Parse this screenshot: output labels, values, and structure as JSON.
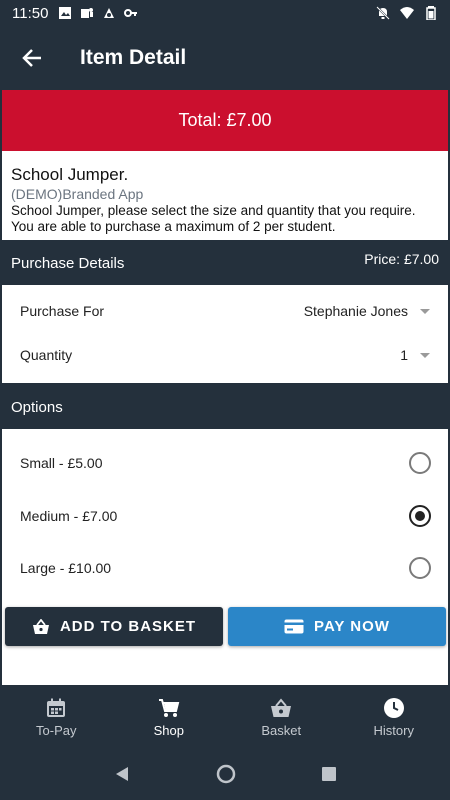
{
  "status": {
    "time": "11:50",
    "left_icons": [
      "image-icon",
      "teams-icon",
      "tomorrow-icon",
      "key-icon"
    ],
    "right_icons": [
      "bell-off-icon",
      "wifi-icon",
      "battery-icon"
    ]
  },
  "app_bar": {
    "title": "Item Detail",
    "back_icon": "arrow-left-icon"
  },
  "total": {
    "label": "Total: £7.00"
  },
  "item": {
    "name": "School Jumper.",
    "vendor": "(DEMO)Branded App",
    "description": "School Jumper, please select the size and quantity that you require. You are able to purchase a maximum of 2 per student."
  },
  "purchase_details": {
    "header": "Purchase Details",
    "price": "Price: £7.00",
    "purchase_for_label": "Purchase For",
    "purchase_for_value": "Stephanie Jones",
    "quantity_label": "Quantity",
    "quantity_value": "1"
  },
  "options": {
    "header": "Options",
    "items": [
      {
        "label": "Small - £5.00",
        "selected": false
      },
      {
        "label": "Medium - £7.00",
        "selected": true
      },
      {
        "label": "Large - £10.00",
        "selected": false
      }
    ]
  },
  "buttons": {
    "add_to_basket": "ADD TO BASKET",
    "pay_now": "PAY NOW"
  },
  "bottom_nav": {
    "items": [
      {
        "label": "To-Pay",
        "icon": "calendar-icon"
      },
      {
        "label": "Shop",
        "icon": "cart-icon",
        "active": true
      },
      {
        "label": "Basket",
        "icon": "basket-icon"
      },
      {
        "label": "History",
        "icon": "clock-icon"
      }
    ]
  },
  "colors": {
    "dark": "#24303c",
    "accent_red": "#cb0f2e",
    "accent_blue": "#2b86c8"
  }
}
